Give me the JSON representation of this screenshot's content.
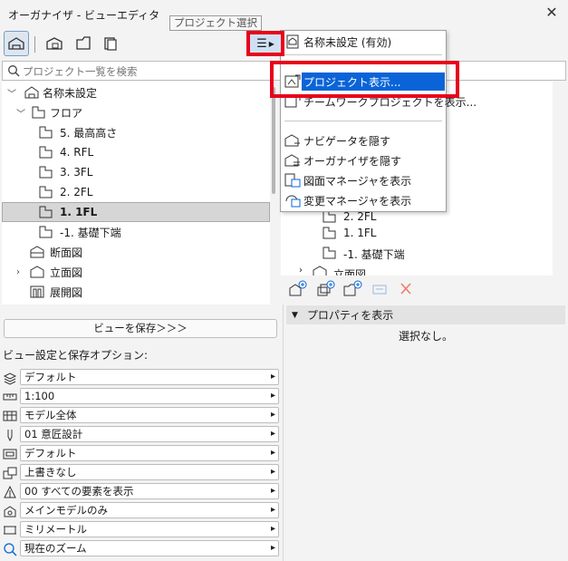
{
  "window": {
    "title": "オーガナイザ - ビューエディタ",
    "close_glyph": "✕"
  },
  "tooltip": "プロジェクト選択",
  "toolbar": {
    "buttons": [
      "project-map-icon",
      "view-map-icon",
      "layout-book-icon",
      "publisher-icon"
    ],
    "menu_icon": "hamburger-menu-icon",
    "menu_arrow": "▶"
  },
  "search": {
    "placeholder": "プロジェクト一覧を検索"
  },
  "tree": {
    "root": "名称未設定",
    "floor_group": "フロア",
    "floors": [
      "5. 最高高さ",
      "4. RFL",
      "3. 3FL",
      "2. 2FL",
      "1. 1FL",
      "-1. 基礎下端"
    ],
    "selected": "1. 1FL",
    "sections": "断面図",
    "elevations": "立面図",
    "interior_elevations": "展開図"
  },
  "popup": {
    "header": "名称未設定 (有効)",
    "items": [
      {
        "label": "プロジェクト表示...",
        "icon": "project-view-icon",
        "highlight": true
      },
      {
        "label": "チームワークプロジェクトを表示...",
        "icon": "teamwork-icon",
        "highlight": false
      },
      {
        "label": "ナビゲータを隠す",
        "icon": "navigator-icon",
        "highlight": false
      },
      {
        "label": "オーガナイザを隠す",
        "icon": "organizer-icon",
        "highlight": false
      },
      {
        "label": "図面マネージャを表示",
        "icon": "drawing-manager-icon",
        "highlight": false
      },
      {
        "label": "変更マネージャを表示",
        "icon": "change-manager-icon",
        "highlight": false
      }
    ]
  },
  "right_tree": {
    "items": [
      "2. 2FL",
      "1. 1FL",
      "-1. 基礎下端",
      "立面図"
    ]
  },
  "save_view_button": "ビューを保存＞＞＞",
  "properties": {
    "header": "プロパティを表示",
    "empty": "選択なし。"
  },
  "options": {
    "label": "ビュー設定と保存オプション:",
    "rows": [
      {
        "icon": "layer-icon",
        "value": "デフォルト"
      },
      {
        "icon": "scale-icon",
        "value": "1:100"
      },
      {
        "icon": "structure-icon",
        "value": "モデル全体"
      },
      {
        "icon": "pen-icon",
        "value": "01 意匠設計"
      },
      {
        "icon": "model-view-icon",
        "value": "デフォルト"
      },
      {
        "icon": "override-icon",
        "value": "上書きなし"
      },
      {
        "icon": "renovation-icon",
        "value": "00 すべての要素を表示"
      },
      {
        "icon": "option-icon",
        "value": "メインモデルのみ"
      },
      {
        "icon": "dimension-icon",
        "value": "ミリメートル"
      },
      {
        "icon": "zoom-icon",
        "value": "現在のズーム"
      }
    ]
  },
  "colors": {
    "highlight": "#0a64d8",
    "annotation_red": "#e8001c",
    "panel_bg": "#f3f3f3"
  }
}
